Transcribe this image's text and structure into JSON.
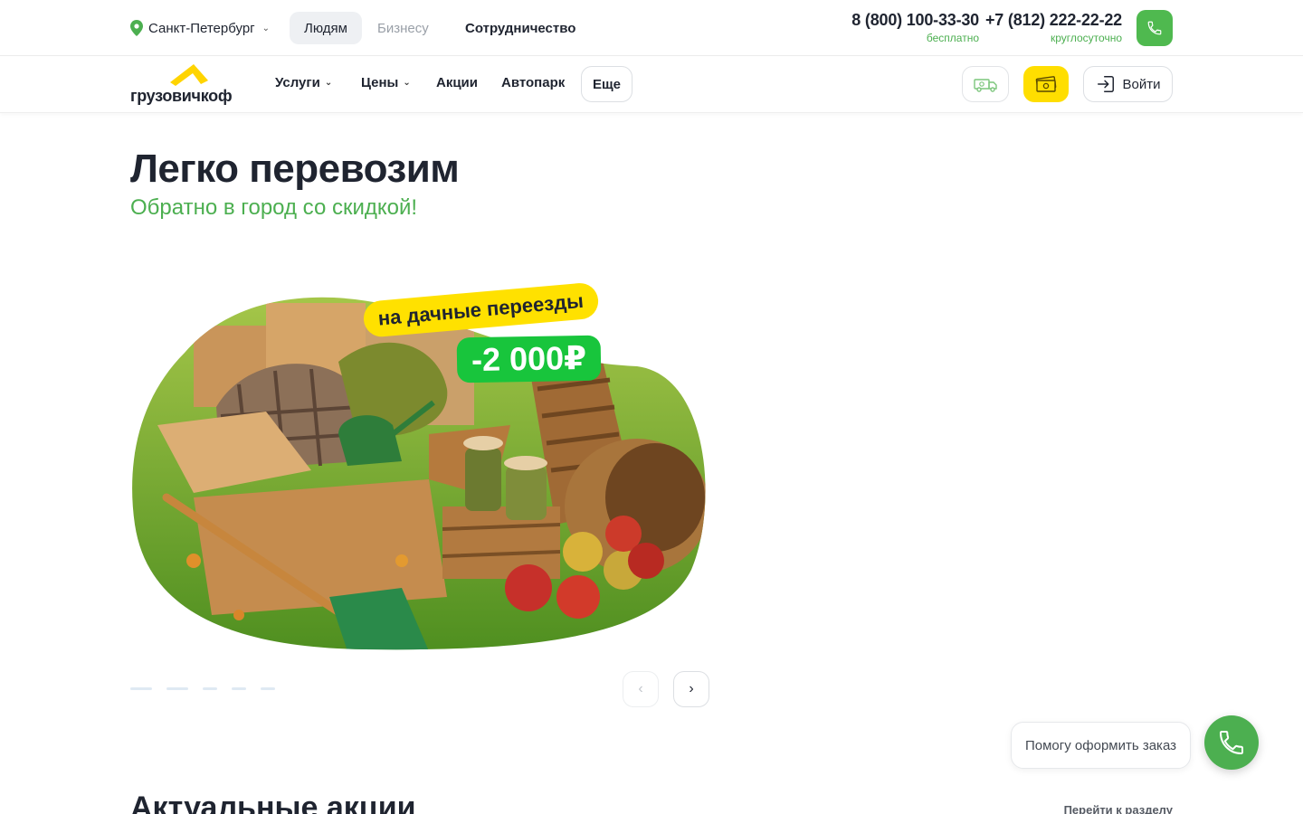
{
  "topbar": {
    "city": "Санкт-Петербург",
    "segments": [
      "Людям",
      "Бизнесу",
      "Сотрудничество"
    ],
    "phones": [
      {
        "number": "8 (800) 100-33-30",
        "note": "бесплатно"
      },
      {
        "number": "+7 (812) 222-22-22",
        "note": "круглосуточно"
      }
    ],
    "call_icon": "phone-icon"
  },
  "nav": {
    "logo_text": "грузовичкоф",
    "items": [
      {
        "label": "Услуги",
        "has_dropdown": true
      },
      {
        "label": "Цены",
        "has_dropdown": true
      },
      {
        "label": "Акции",
        "has_dropdown": false
      },
      {
        "label": "Автопарк",
        "has_dropdown": false
      }
    ],
    "more_label": "Еще",
    "icon_buttons": [
      "truck-money-icon",
      "cash-icon"
    ],
    "login_label": "Войти"
  },
  "hero": {
    "title": "Легко перевозим",
    "subtitle": "Обратно в город со скидкой!"
  },
  "banner": {
    "badge_text": "на дачные переезды",
    "discount_text": "-2 000₽",
    "slide_count": 5,
    "active_slide": 1
  },
  "section": {
    "title": "Актуальные акции",
    "link": "Перейти к разделу"
  },
  "help": {
    "label": "Помогу оформить заказ"
  },
  "colors": {
    "brand_green": "#4caf50",
    "brand_yellow": "#ffde00",
    "discount_green": "#18c53c",
    "text_dark": "#1f2430"
  }
}
